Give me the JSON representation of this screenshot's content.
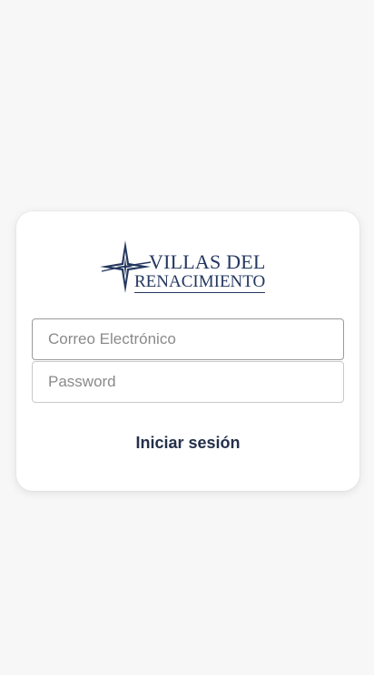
{
  "brand": {
    "line1": "VILLAS DEL",
    "line2": "RENACIMIENTO",
    "color": "#23375f",
    "logo_icon": "compass-star-icon"
  },
  "login_form": {
    "email_placeholder": "Correo Electrónico",
    "email_value": "",
    "password_placeholder": "Password",
    "password_value": "",
    "submit_label": "Iniciar sesión"
  },
  "colors": {
    "background": "#f7f7f7",
    "card": "#ffffff",
    "button_text": "#24304a"
  }
}
